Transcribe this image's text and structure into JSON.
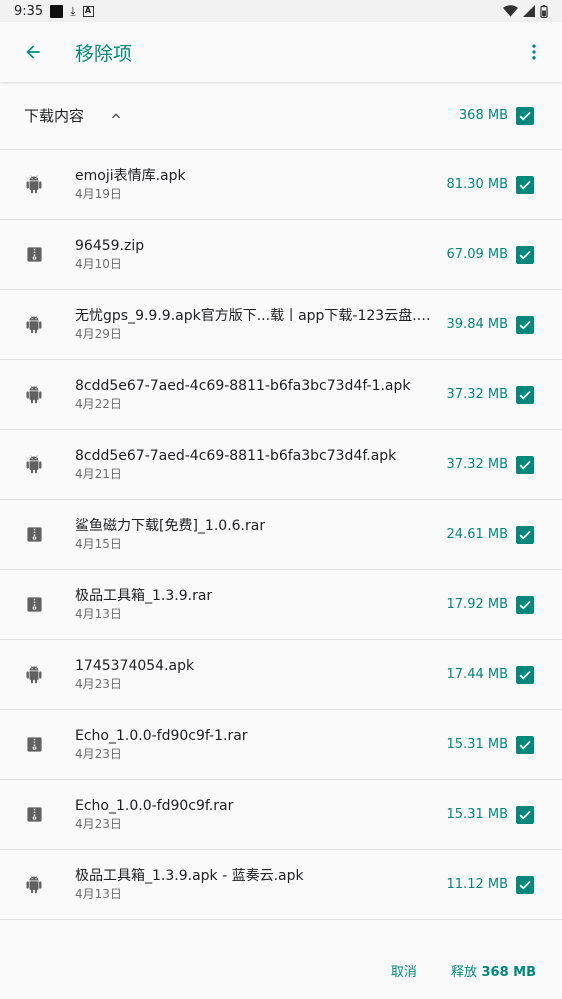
{
  "status_bar": {
    "time": "9:35"
  },
  "app_bar": {
    "title": "移除项"
  },
  "section": {
    "title": "下载内容",
    "size": "368 MB"
  },
  "files": [
    {
      "icon": "android-icon",
      "name": "emoji表情库.apk",
      "date": "4月19日",
      "size": "81.30 MB"
    },
    {
      "icon": "zip-icon",
      "name": "96459.zip",
      "date": "4月10日",
      "size": "67.09 MB"
    },
    {
      "icon": "android-icon",
      "name": "无忧gps_9.9.9.apk官方版下...载丨app下载-123云盘.apk",
      "date": "4月29日",
      "size": "39.84 MB"
    },
    {
      "icon": "android-icon",
      "name": "8cdd5e67-7aed-4c69-8811-b6fa3bc73d4f-1.apk",
      "date": "4月22日",
      "size": "37.32 MB"
    },
    {
      "icon": "android-icon",
      "name": "8cdd5e67-7aed-4c69-8811-b6fa3bc73d4f.apk",
      "date": "4月21日",
      "size": "37.32 MB"
    },
    {
      "icon": "zip-icon",
      "name": "鲨鱼磁力下载[免费]_1.0.6.rar",
      "date": "4月15日",
      "size": "24.61 MB"
    },
    {
      "icon": "zip-icon",
      "name": "极品工具箱_1.3.9.rar",
      "date": "4月13日",
      "size": "17.92 MB"
    },
    {
      "icon": "android-icon",
      "name": "1745374054.apk",
      "date": "4月23日",
      "size": "17.44 MB"
    },
    {
      "icon": "zip-icon",
      "name": "Echo_1.0.0-fd90c9f-1.rar",
      "date": "4月23日",
      "size": "15.31 MB"
    },
    {
      "icon": "zip-icon",
      "name": "Echo_1.0.0-fd90c9f.rar",
      "date": "4月23日",
      "size": "15.31 MB"
    },
    {
      "icon": "android-icon",
      "name": "极品工具箱_1.3.9.apk - 蓝奏云.apk",
      "date": "4月13日",
      "size": "11.12 MB"
    }
  ],
  "footer": {
    "cancel_label": "取消",
    "free_label": "释放",
    "free_size": "368 MB"
  },
  "colors": {
    "accent": "#00897b",
    "icon_gray": "#616161"
  }
}
